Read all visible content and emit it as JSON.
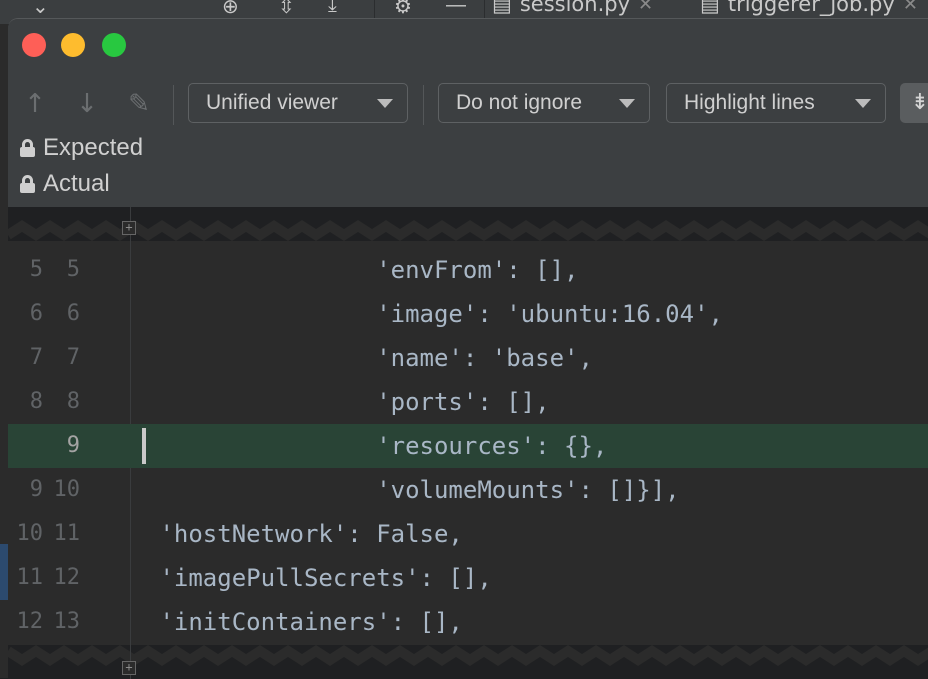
{
  "ide_tabs": [
    {
      "label": "session.py"
    },
    {
      "label": "triggerer_job.py"
    }
  ],
  "window": {
    "controls": [
      "close",
      "minimize",
      "maximize"
    ]
  },
  "toolbar": {
    "viewer_label": "Unified viewer",
    "ignore_label": "Do not ignore",
    "highlight_label": "Highlight lines"
  },
  "files": {
    "expected": "Expected",
    "actual": "Actual"
  },
  "editor": {
    "lines": [
      {
        "left": "5",
        "right": "5",
        "code": "                'envFrom': [],",
        "highlight": false
      },
      {
        "left": "6",
        "right": "6",
        "code": "                'image': 'ubuntu:16.04',",
        "highlight": false
      },
      {
        "left": "7",
        "right": "7",
        "code": "                'name': 'base',",
        "highlight": false
      },
      {
        "left": "8",
        "right": "8",
        "code": "                'ports': [],",
        "highlight": false
      },
      {
        "left": "",
        "right": "9",
        "code": "                'resources': {},",
        "highlight": true
      },
      {
        "left": "9",
        "right": "10",
        "code": "                'volumeMounts': []}],",
        "highlight": false
      },
      {
        "left": "10",
        "right": "11",
        "code": " 'hostNetwork': False,",
        "highlight": false
      },
      {
        "left": "11",
        "right": "12",
        "code": " 'imagePullSecrets': [],",
        "highlight": false
      },
      {
        "left": "12",
        "right": "13",
        "code": " 'initContainers': [],",
        "highlight": false
      }
    ]
  },
  "colors": {
    "added_line_bg": "#294436",
    "code_text": "#a9b7c6"
  }
}
